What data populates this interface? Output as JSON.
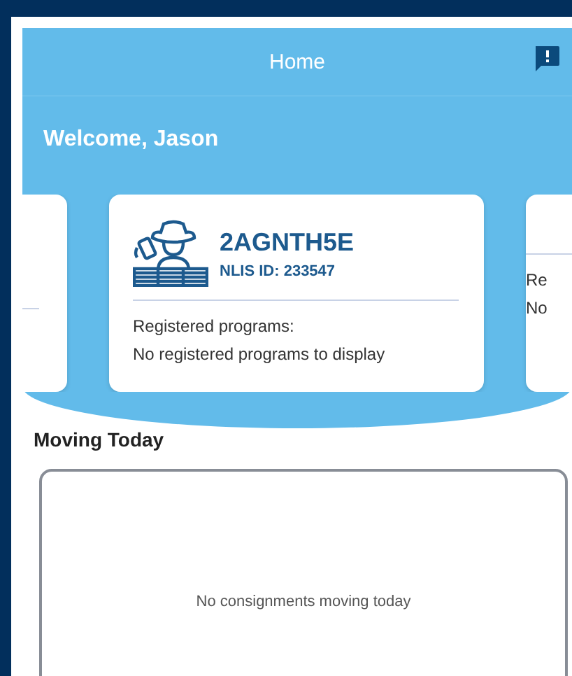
{
  "header": {
    "title": "Home"
  },
  "welcome": "Welcome, Jason",
  "carousel": {
    "current_card": {
      "title": "2AGNTH5E",
      "subtitle": "NLIS ID: 233547",
      "programs_label": "Registered programs:",
      "programs_text": "No registered programs to display"
    },
    "next_card": {
      "programs_label": "Re",
      "programs_text": "No"
    }
  },
  "moving_today": {
    "heading": "Moving Today",
    "empty_text": "No consignments moving today"
  }
}
